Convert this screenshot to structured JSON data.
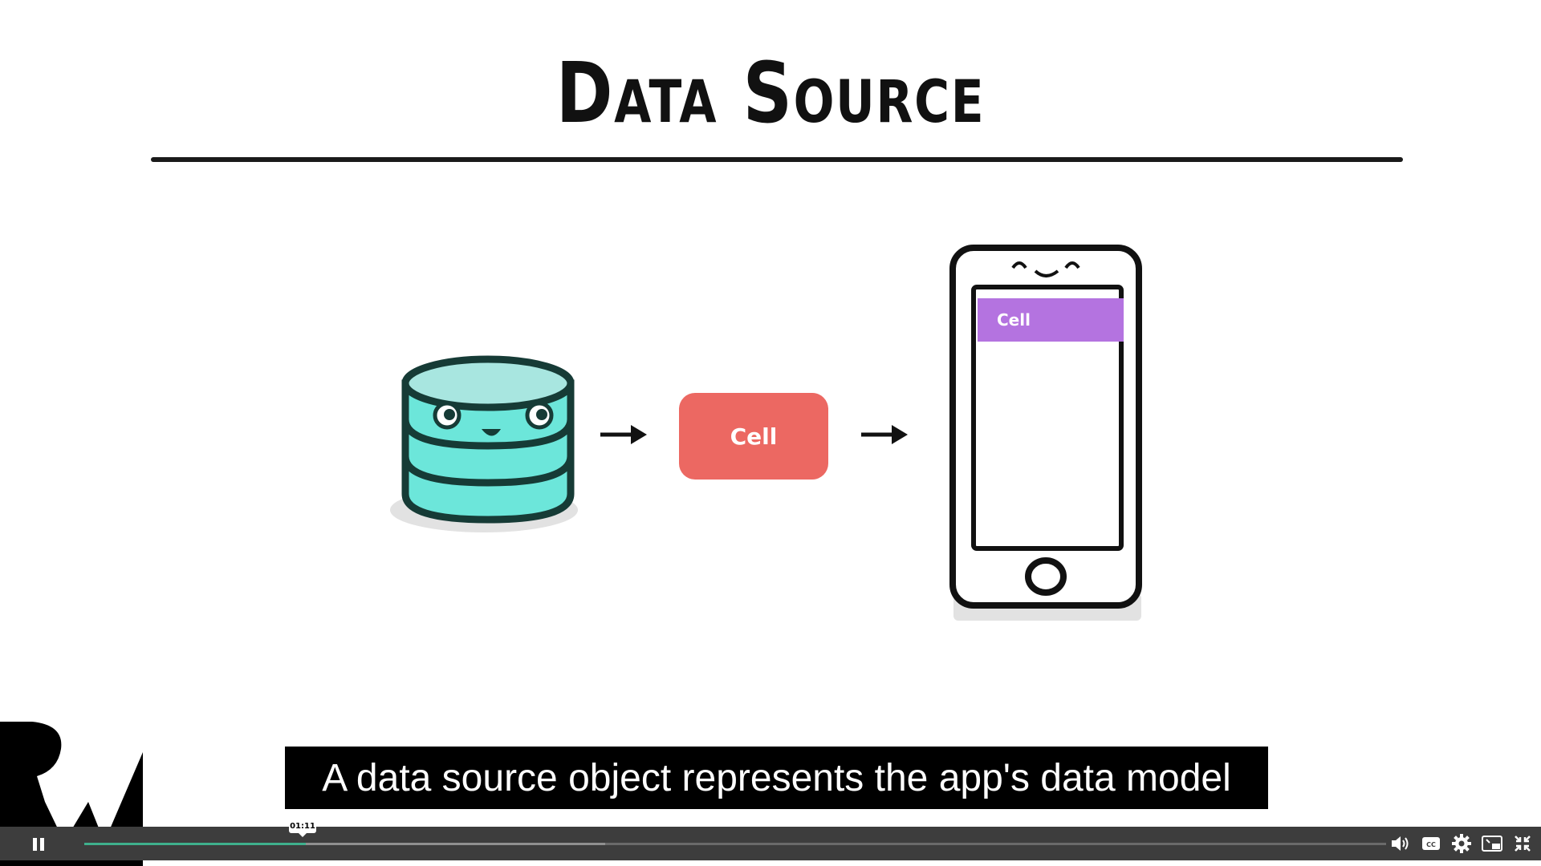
{
  "slide": {
    "title": "Data Source",
    "cell_label": "Cell",
    "phone_cell_label": "Cell"
  },
  "caption": {
    "text": "A data source object represents the app's data model"
  },
  "player": {
    "time_tooltip": "01:11",
    "progress_fraction": 0.17,
    "buffered_fraction": 0.4,
    "cc_label": "CC",
    "colors": {
      "bar_bg": "#3d3d3d",
      "played": "#3fb08c",
      "buffer": "#8f8f8f"
    }
  },
  "icons": {
    "pause": "pause-icon",
    "volume": "volume-icon",
    "captions": "captions-icon",
    "settings": "gear-icon",
    "pip": "picture-in-picture-icon",
    "exit_fullscreen": "exit-fullscreen-icon",
    "logo": "rw-logo"
  }
}
